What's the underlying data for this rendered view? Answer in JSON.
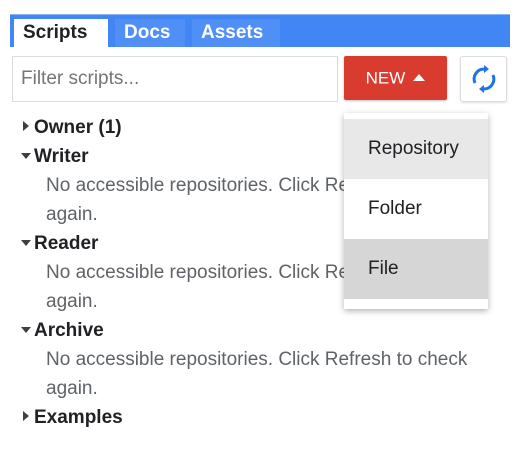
{
  "tabs": [
    {
      "label": "Scripts",
      "active": true
    },
    {
      "label": "Docs",
      "active": false
    },
    {
      "label": "Assets",
      "active": false
    }
  ],
  "filter": {
    "placeholder": "Filter scripts...",
    "value": ""
  },
  "new_button": {
    "label": "NEW",
    "icon": "caret-up-icon"
  },
  "refresh_button": {
    "icon": "refresh-icon"
  },
  "tree": {
    "owner": {
      "label": "Owner (1)",
      "expanded": false
    },
    "writer": {
      "label": "Writer",
      "expanded": true,
      "message": "No accessible repositories. Click Refresh to check again."
    },
    "reader": {
      "label": "Reader",
      "expanded": true,
      "message": "No accessible repositories. Click Refresh to check again."
    },
    "archive": {
      "label": "Archive",
      "expanded": true,
      "message": "No accessible repositories. Click Refresh to check again."
    },
    "examples": {
      "label": "Examples",
      "expanded": false
    }
  },
  "new_menu": {
    "items": [
      "Repository",
      "Folder",
      "File"
    ]
  },
  "colors": {
    "tab_bar": "#4285f4",
    "new_button": "#d93c2f",
    "refresh_icon": "#1a73e8"
  }
}
